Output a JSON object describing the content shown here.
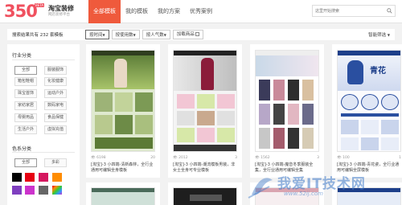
{
  "logo": {
    "number": "350",
    "beta": "BETA",
    "name": "淘宝装修",
    "subtitle": "网店装修平台"
  },
  "nav": [
    {
      "label": "全部模板",
      "active": true
    },
    {
      "label": "我的模板",
      "active": false
    },
    {
      "label": "我的方案",
      "active": false
    },
    {
      "label": "优秀案例",
      "active": false
    }
  ],
  "search": {
    "placeholder": "这里开始搜索"
  },
  "filter": {
    "count_prefix": "搜索结果共有",
    "count_value": "232",
    "count_suffix": "套模板",
    "sort": [
      {
        "label": "按时间",
        "arrow": "▼",
        "active": true
      },
      {
        "label": "按使用数",
        "arrow": "▼",
        "active": false
      },
      {
        "label": "按人气数",
        "arrow": "▼",
        "active": false
      }
    ],
    "checkbox_label": "加载商品",
    "settings_label": "智能筛选"
  },
  "sidebar": {
    "industry_title": "行业分类",
    "industry_tags": [
      "全部",
      "服装服饰",
      "箱包鞋帽",
      "化妆健康",
      "珠宝首饰",
      "运动户外",
      "家纺家居",
      "数码家电",
      "母婴用品",
      "食品保健",
      "生活户外",
      "虚拟充值"
    ],
    "color_title": "色系分类",
    "color_tags": [
      "全部",
      "多彩"
    ],
    "swatches": [
      "#000000",
      "#e60012",
      "#d5175f",
      "#ff8c00",
      "#7f3fbf",
      "#cc33cc",
      "#666666",
      "#6699cc"
    ]
  },
  "cards": [
    {
      "views": "6198",
      "likes": "20",
      "desc": "[淘宝]-3 小四端-清新森林，全行业通用可编辑全身模板"
    },
    {
      "views": "2012",
      "likes": "3",
      "desc": "[淘宝]-3 小四端-潮流模板男装，非女士全身可专业模板"
    },
    {
      "views": "1562",
      "likes": "3",
      "desc": "[淘宝]-3 小四端-魔音冬季服装全集，全行业通用可编辑全集"
    },
    {
      "views": "100",
      "likes": "1",
      "desc": "[淘宝]-3 小四端-青花瓷，全行业通用可编辑全屏模板"
    }
  ],
  "watermark": {
    "text": "我爱IT技术网",
    "url": "www.52ij.com"
  }
}
